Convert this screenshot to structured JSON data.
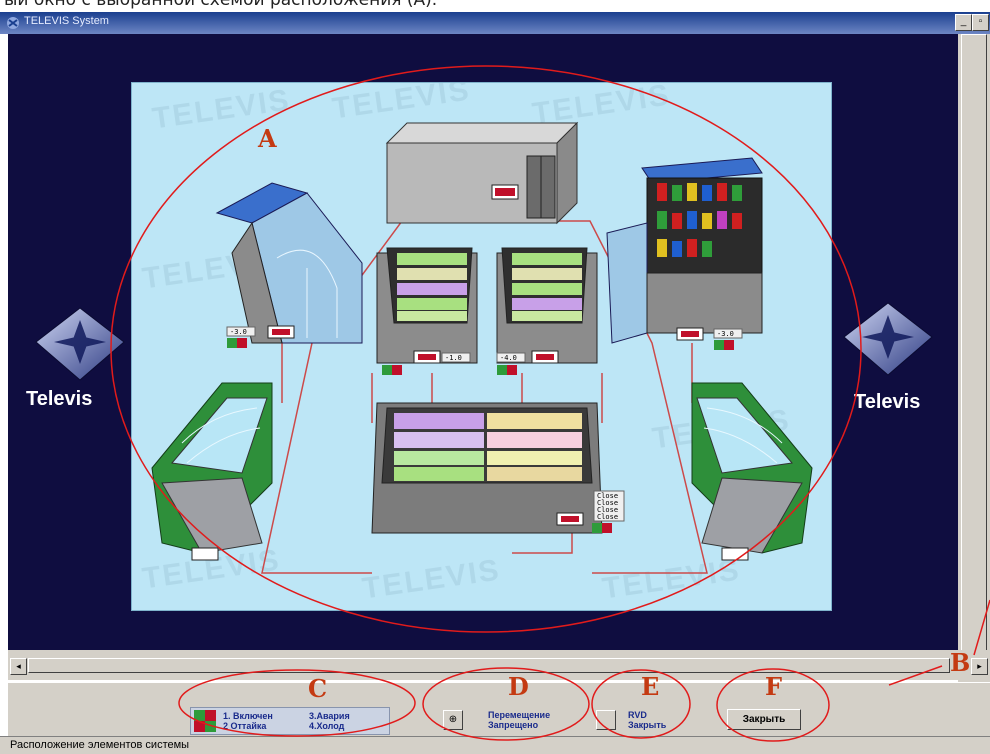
{
  "caption": {
    "text": "ый окно с выбранной схемой расположения (A)."
  },
  "window": {
    "title": "TELEVIS System",
    "controls": {
      "minimize": "_",
      "maximize": "▫"
    }
  },
  "brand": {
    "left_label": "Televis",
    "right_label": "Televis",
    "watermark": "TELEVIS"
  },
  "annotations": {
    "A": "A",
    "B": "B",
    "C": "C",
    "D": "D",
    "E": "E",
    "F": "F"
  },
  "scene": {
    "readouts": {
      "left_case": "-3.0",
      "center_left": "-1.0",
      "center_right": "-4.0",
      "right_case": "-3.0",
      "cold_room": "",
      "bottom_stack": [
        "Close",
        "Close",
        "Close",
        "Close"
      ]
    }
  },
  "toolbar": {
    "legend": {
      "l1": "1. Включен",
      "l2": "2 Оттайка",
      "l3": "3.Авария",
      "l4": "4.Холод"
    },
    "move": {
      "line1": "Перемещение",
      "line2": "Запрещено"
    },
    "rvd": {
      "line1": "RVD",
      "line2": "Закрыть"
    },
    "close_button": "Закрыть"
  },
  "status": {
    "text": "Расположение элементов системы"
  },
  "colors": {
    "background": "#0f0d40",
    "scene": "#bde6f6",
    "annotation": "#c43a12",
    "circle": "#e11b1b",
    "titlebar": "#1a3f8f"
  }
}
